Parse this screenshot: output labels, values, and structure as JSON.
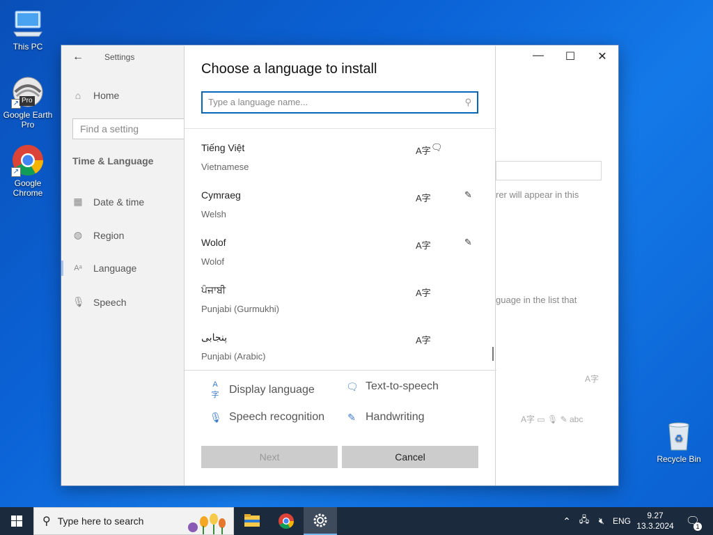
{
  "desktop": {
    "icons": [
      {
        "label": "This PC"
      },
      {
        "label": "Google Earth Pro",
        "badge": "Pro"
      },
      {
        "label": "Google Chrome"
      },
      {
        "label": "Recycle Bin"
      }
    ]
  },
  "settings": {
    "app_title": "Settings",
    "nav": {
      "home": "Home",
      "find_placeholder": "Find a setting",
      "section_title": "Time & Language",
      "items": [
        "Date & time",
        "Region",
        "Language",
        "Speech"
      ]
    },
    "background": {
      "text1": "rer will appear in this",
      "text2": "guage in the list that"
    }
  },
  "dialog": {
    "title": "Choose a language to install",
    "search_placeholder": "Type a language name...",
    "languages": [
      {
        "native": "Tiếng Việt",
        "english": "Vietnamese",
        "features": [
          "display-language",
          "text-to-speech"
        ]
      },
      {
        "native": "Cymraeg",
        "english": "Welsh",
        "features": [
          "display-language",
          "handwriting"
        ]
      },
      {
        "native": "Wolof",
        "english": "Wolof",
        "features": [
          "display-language",
          "handwriting"
        ]
      },
      {
        "native": "ਪੰਜਾਬੀ",
        "english": "Punjabi (Gurmukhi)",
        "features": [
          "display-language"
        ]
      },
      {
        "native": "پنجابی",
        "english": "Punjabi (Arabic)",
        "features": [
          "display-language"
        ]
      }
    ],
    "legend": {
      "display_language": "Display language",
      "text_to_speech": "Text-to-speech",
      "speech_recognition": "Speech recognition",
      "handwriting": "Handwriting"
    },
    "buttons": {
      "next": "Next",
      "cancel": "Cancel"
    }
  },
  "taskbar": {
    "search_placeholder": "Type here to search",
    "language": "ENG",
    "time": "9.27",
    "date": "13.3.2024",
    "notification_count": "1"
  }
}
